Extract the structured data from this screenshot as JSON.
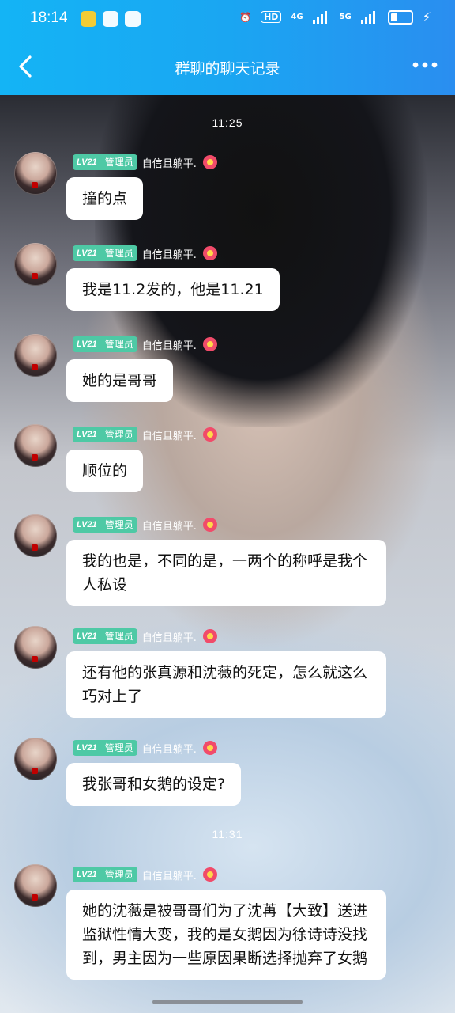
{
  "status_bar": {
    "time": "18:14",
    "hd": "HD",
    "net1": "4G",
    "net2": "5G"
  },
  "header": {
    "title": "群聊的聊天记录"
  },
  "chat": {
    "timestamps": [
      "11:25",
      "11:31"
    ],
    "messages": [
      {
        "level": "LV21",
        "role": "管理员",
        "nickname": "自信且躺平.",
        "text": "撞的点"
      },
      {
        "level": "LV21",
        "role": "管理员",
        "nickname": "自信且躺平.",
        "text": "我是11.2发的，他是11.21"
      },
      {
        "level": "LV21",
        "role": "管理员",
        "nickname": "自信且躺平.",
        "text": "她的是哥哥"
      },
      {
        "level": "LV21",
        "role": "管理员",
        "nickname": "自信且躺平.",
        "text": "顺位的"
      },
      {
        "level": "LV21",
        "role": "管理员",
        "nickname": "自信且躺平.",
        "text": "我的也是，不同的是，一两个的称呼是我个人私设"
      },
      {
        "level": "LV21",
        "role": "管理员",
        "nickname": "自信且躺平.",
        "text": "还有他的张真源和沈薇的死定，怎么就这么巧对上了"
      },
      {
        "level": "LV21",
        "role": "管理员",
        "nickname": "自信且躺平.",
        "text": "我张哥和女鹅的设定?"
      },
      {
        "level": "LV21",
        "role": "管理员",
        "nickname": "自信且躺平.",
        "text": "她的沈薇是被哥哥们为了沈苒【大致】送进监狱性情大变，我的是女鹅因为徐诗诗没找到，男主因为一些原因果断选择抛弃了女鹅"
      }
    ]
  }
}
